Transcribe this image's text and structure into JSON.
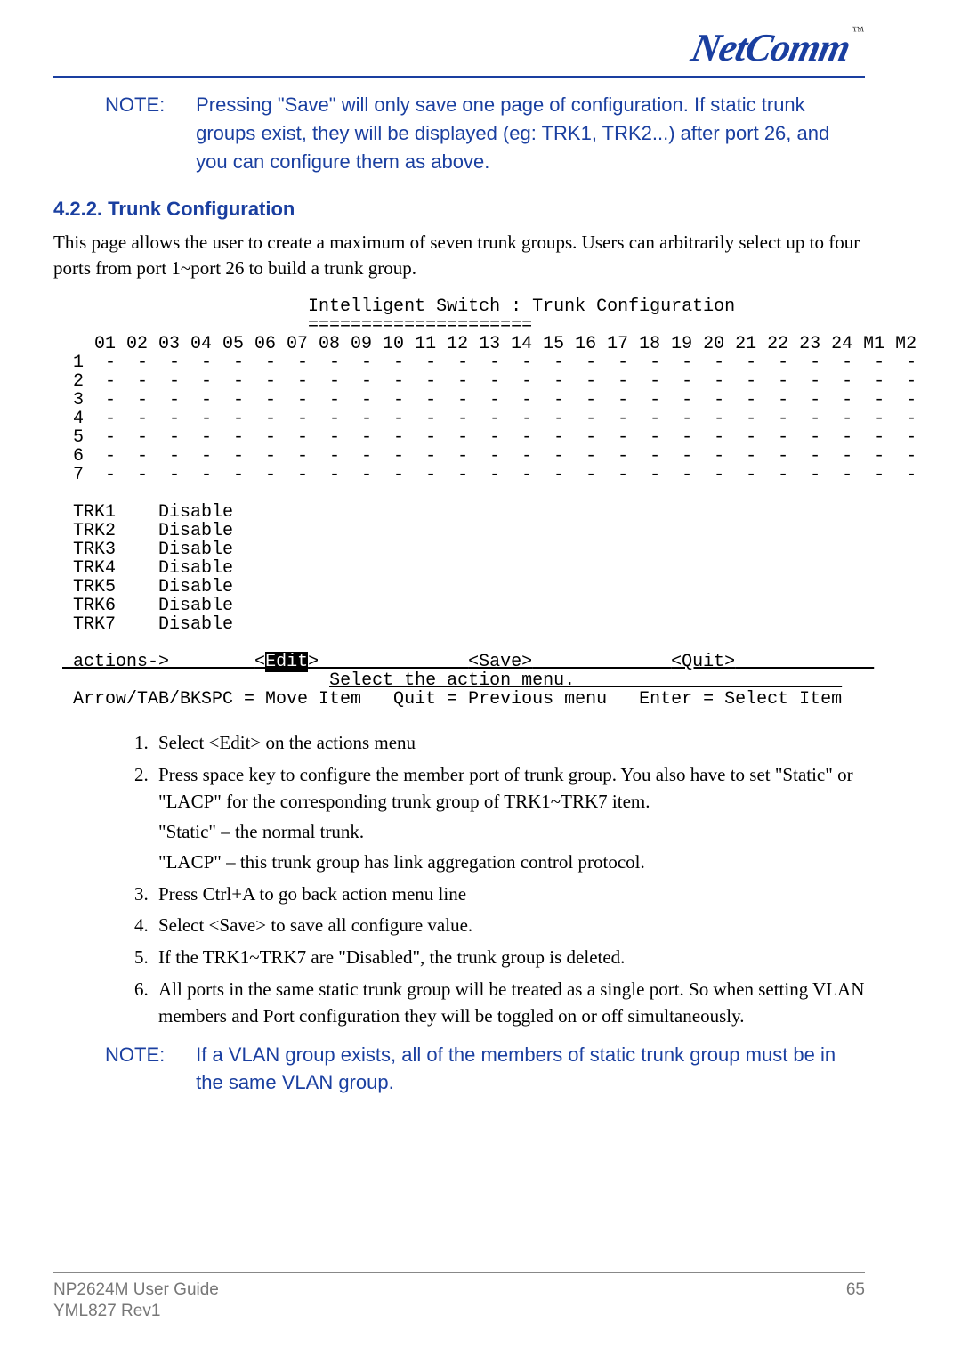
{
  "logo_text": "NetComm",
  "logo_tm": "™",
  "note1": {
    "label": "NOTE:",
    "body": "Pressing \"Save\" will only save one page of configuration.  If static trunk groups exist, they will be displayed (eg: TRK1, TRK2...) after port 26, and you can configure them as above."
  },
  "section_number": "4.2.2.",
  "section_title": "Trunk Configuration",
  "intro": "This page allows the user to create a maximum of seven trunk groups.  Users can arbitrarily select up to four ports from port 1~port 26 to build a trunk group.",
  "terminal": {
    "title_line": "                       Intelligent Switch : Trunk Configuration",
    "title_sep": "                       =====================",
    "header": "   01 02 03 04 05 06 07 08 09 10 11 12 13 14 15 16 17 18 19 20 21 22 23 24 M1 M2",
    "rows": [
      " 1  -  -  -  -  -  -  -  -  -  -  -  -  -  -  -  -  -  -  -  -  -  -  -  -  -  -",
      " 2  -  -  -  -  -  -  -  -  -  -  -  -  -  -  -  -  -  -  -  -  -  -  -  -  -  -",
      " 3  -  -  -  -  -  -  -  -  -  -  -  -  -  -  -  -  -  -  -  -  -  -  -  -  -  -",
      " 4  -  -  -  -  -  -  -  -  -  -  -  -  -  -  -  -  -  -  -  -  -  -  -  -  -  -",
      " 5  -  -  -  -  -  -  -  -  -  -  -  -  -  -  -  -  -  -  -  -  -  -  -  -  -  -",
      " 6  -  -  -  -  -  -  -  -  -  -  -  -  -  -  -  -  -  -  -  -  -  -  -  -  -  -",
      " 7  -  -  -  -  -  -  -  -  -  -  -  -  -  -  -  -  -  -  -  -  -  -  -  -  -  -"
    ],
    "trk_lines": [
      " TRK1    Disable",
      " TRK2    Disable",
      " TRK3    Disable",
      " TRK4    Disable",
      " TRK5    Disable",
      " TRK6    Disable",
      " TRK7    Disable"
    ],
    "actions_prefix": " actions->        ",
    "actions_edit_lead": "<",
    "actions_edit": "Edit",
    "actions_gap1": ">              ",
    "actions_save": "<Save>",
    "actions_gap2": "             ",
    "actions_quit": "<Quit>",
    "actions_trail": "             ",
    "select_menu_pad": "                         ",
    "select_menu": "Select the action menu.                         ",
    "nav_line": " Arrow/TAB/BKSPC = Move Item   Quit = Previous menu   Enter = Select Item"
  },
  "steps": [
    "Select <Edit> on the actions menu",
    "Press space key to configure the member port of trunk group.  You also have to set \"Static\" or \"LACP\" for the corresponding trunk group of TRK1~TRK7 item.",
    "Press Ctrl+A to go back action menu line",
    "Select <Save> to save all configure value.",
    "If the TRK1~TRK7 are \"Disabled\", the trunk group is deleted.",
    "All ports in the same static trunk group will be treated as a single port.  So when setting VLAN members and Port configuration they will be toggled on or off simultaneously."
  ],
  "step2_extra1": "\"Static\" – the normal trunk.",
  "step2_extra2": "\"LACP\" – this trunk group has link aggregation control protocol.",
  "note2": {
    "label": "NOTE:",
    "body": "If a VLAN group exists, all of the members of static trunk group must be in the same VLAN group."
  },
  "footer": {
    "left": "NP2624M User Guide",
    "page": "65",
    "sub": "YML827 Rev1"
  }
}
